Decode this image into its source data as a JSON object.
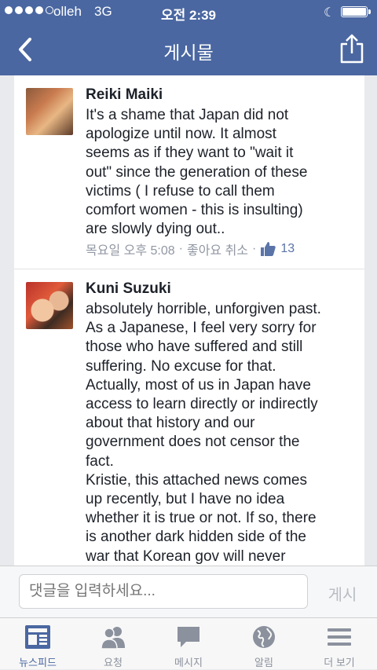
{
  "status_bar": {
    "carrier": "olleh",
    "network": "3G",
    "time": "오전 2:39",
    "signal_dots_filled": 4,
    "signal_dots_total": 5
  },
  "nav": {
    "title": "게시물",
    "back_icon": "chevron-left-icon",
    "share_icon": "share-icon"
  },
  "comments": [
    {
      "author": "Reiki Maiki",
      "text": "It's a shame that Japan did not\napologize until now. It almost\nseems as if they want to \"wait it\nout\" since the generation of these\nvictims ( I refuse to call them\ncomfort women - this is insulting)\nare slowly dying out..",
      "time": "목요일 오후 5:08",
      "separator": "·",
      "like_action": "좋아요 취소",
      "like_count": "13"
    },
    {
      "author": "Kuni Suzuki",
      "text": "absolutely horrible, unforgiven past.\nAs a Japanese, I feel very sorry for\nthose who have suffered and still\nsuffering. No excuse for that.\nActually, most of us in Japan  have\naccess to learn directly or indirectly\nabout that history and our\ngovernment does not censor the\nfact.\nKristie, this attached news comes\nup recently, but I have no idea\nwhether it is true or not.  If so, there\nis another dark hidden side of the\nwar that Korean gov will never"
    }
  ],
  "composer": {
    "placeholder": "댓글을 입력하세요...",
    "post_label": "게시"
  },
  "tabs": [
    {
      "label": "뉴스피드",
      "icon": "newsfeed-icon",
      "active": true
    },
    {
      "label": "요청",
      "icon": "friend-requests-icon",
      "active": false
    },
    {
      "label": "메시지",
      "icon": "messages-icon",
      "active": false
    },
    {
      "label": "알림",
      "icon": "notifications-globe-icon",
      "active": false
    },
    {
      "label": "더 보기",
      "icon": "more-menu-icon",
      "active": false
    }
  ],
  "colors": {
    "header": "#4a67a1",
    "background": "#e9eaed",
    "meta": "#9197a3",
    "link": "#5b74a8"
  }
}
